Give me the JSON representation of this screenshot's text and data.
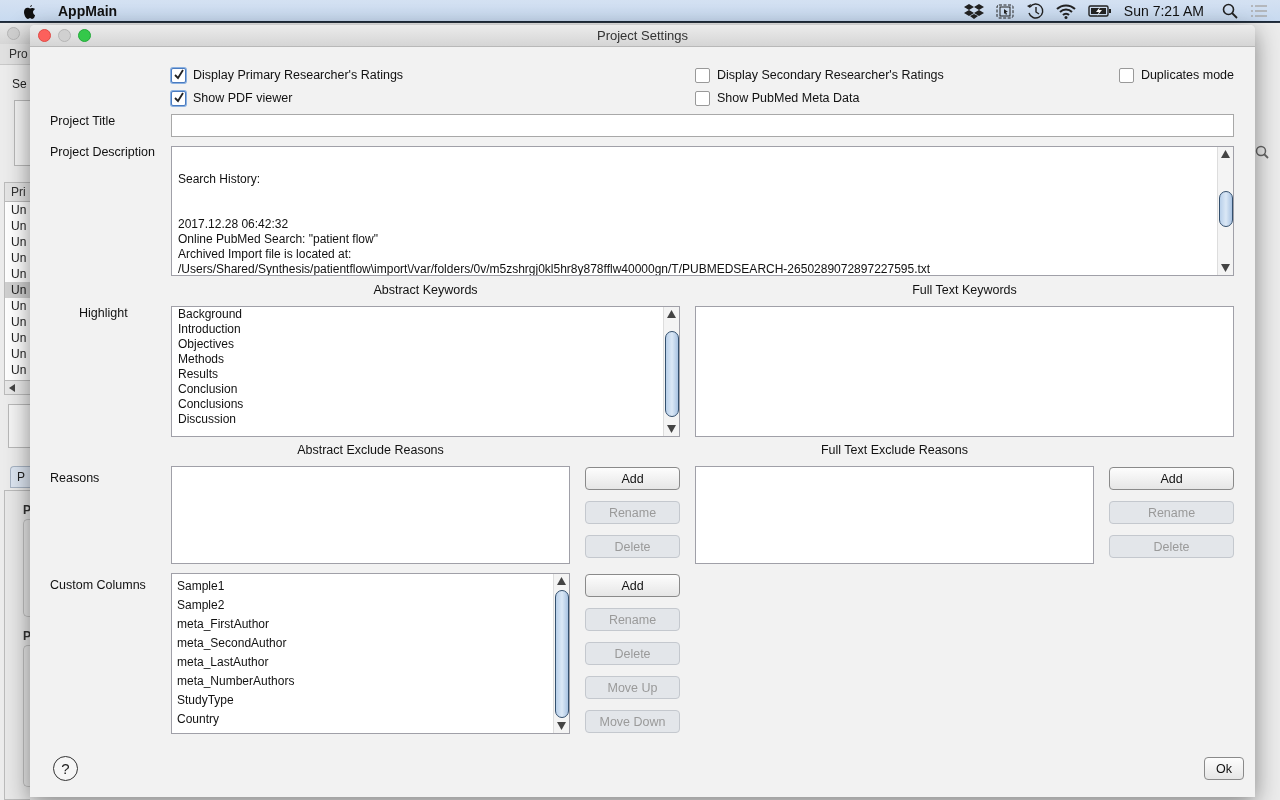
{
  "menu_bar": {
    "app_name": "AppMain",
    "clock": "Sun 7:21 AM"
  },
  "background_window": {
    "menu_label": "Pro",
    "search_label": "Se",
    "table_header": "Pri",
    "rows": [
      {
        "text": "Un",
        "selected": false
      },
      {
        "text": "Un",
        "selected": false
      },
      {
        "text": "Un",
        "selected": false
      },
      {
        "text": "Un",
        "selected": false
      },
      {
        "text": "Un",
        "selected": false
      },
      {
        "text": "Un",
        "selected": true
      },
      {
        "text": "Un",
        "selected": false
      },
      {
        "text": "Un",
        "selected": false
      },
      {
        "text": "Un",
        "selected": false
      },
      {
        "text": "Un",
        "selected": false
      },
      {
        "text": "Un",
        "selected": false
      }
    ],
    "tab": "P",
    "panel_labels": [
      "P",
      "P"
    ]
  },
  "dialog": {
    "title": "Project Settings",
    "option_rows": [
      [
        {
          "label": "Display Primary Researcher's Ratings",
          "checked": true
        },
        {
          "label": "Display Secondary Researcher's Ratings",
          "checked": false
        },
        {
          "label": "Duplicates mode",
          "checked": false
        }
      ],
      [
        {
          "label": "Show PDF viewer",
          "checked": true
        },
        {
          "label": "Show PubMed Meta Data",
          "checked": false
        }
      ]
    ],
    "project_title": {
      "label": "Project Title"
    },
    "project_description": {
      "label": "Project Description",
      "sections": [
        [
          "Search History:"
        ],
        [
          "2017.12.28 06:42:32",
          "Online PubMed Search: \"patient flow\"",
          "Archived Import file is located at:",
          "/Users/Shared/Synthesis/patientflow\\import\\/var/folders/0v/m5zshrgj0kl5hr8y878fflw40000gn/T/PUBMEDSEARCH-2650289072897227595.txt"
        ]
      ]
    },
    "highlight": {
      "label": "Highlight",
      "abstract_keywords": {
        "heading": "Abstract Keywords",
        "items": [
          "Background",
          "Introduction",
          "Objectives",
          "Methods",
          "Results",
          "Conclusion",
          "Conclusions",
          "Discussion"
        ]
      },
      "full_text_keywords": {
        "heading": "Full Text Keywords"
      }
    },
    "reasons": {
      "label": "Reasons",
      "abstract": {
        "heading": "Abstract Exclude Reasons",
        "buttons": [
          {
            "label": "Add",
            "disabled": false
          },
          {
            "label": "Rename",
            "disabled": true
          },
          {
            "label": "Delete",
            "disabled": true
          }
        ]
      },
      "full_text": {
        "heading": "Full Text Exclude Reasons",
        "buttons": [
          {
            "label": "Add",
            "disabled": false
          },
          {
            "label": "Rename",
            "disabled": true
          },
          {
            "label": "Delete",
            "disabled": true
          }
        ]
      }
    },
    "custom_columns": {
      "label": "Custom Columns",
      "items": [
        "Sample1",
        "Sample2",
        "meta_FirstAuthor",
        "meta_SecondAuthor",
        "meta_LastAuthor",
        "meta_NumberAuthors",
        "StudyType",
        "Country"
      ],
      "buttons": [
        {
          "label": "Add",
          "disabled": false
        },
        {
          "label": "Rename",
          "disabled": true
        },
        {
          "label": "Delete",
          "disabled": true
        },
        {
          "label": "Move Up",
          "disabled": true
        },
        {
          "label": "Move Down",
          "disabled": true
        }
      ]
    },
    "footer": {
      "help": "?",
      "ok": "Ok"
    }
  }
}
